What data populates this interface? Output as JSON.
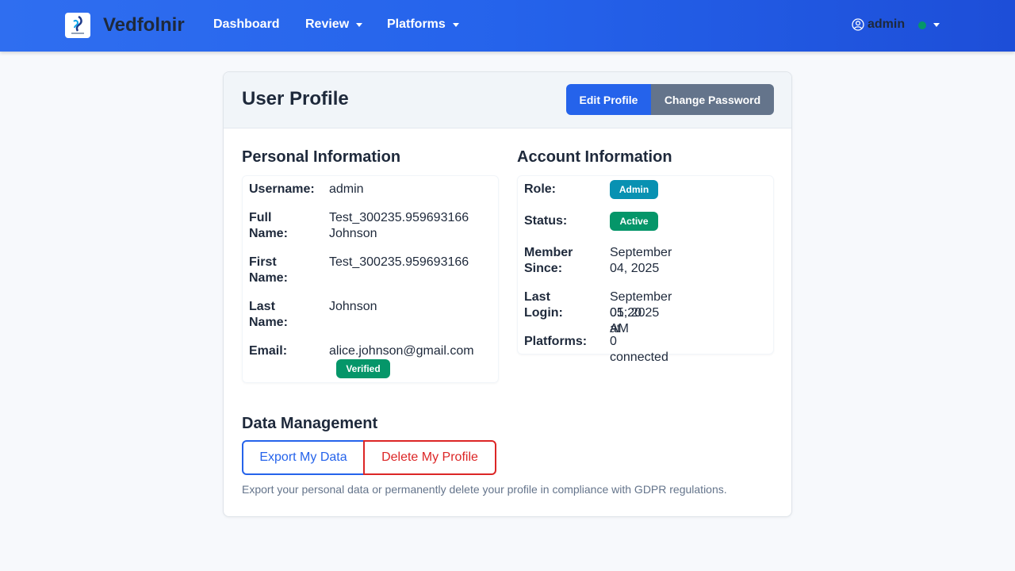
{
  "brand": {
    "name": "Vedfolnir"
  },
  "nav": {
    "dashboard": "Dashboard",
    "review": "Review",
    "platforms": "Platforms"
  },
  "user_menu": {
    "username": "admin",
    "status_color": "#059669"
  },
  "profile": {
    "title": "User Profile",
    "edit_button": "Edit Profile",
    "change_password_button": "Change Password",
    "personal": {
      "heading": "Personal Information",
      "username_label": "Username:",
      "username": "admin",
      "full_name_label": "Full Name:",
      "full_name_line1": "Test_300235.959693166",
      "full_name_line2": "Johnson",
      "first_name_label_1": "First",
      "first_name_label_2": "Name:",
      "first_name": "Test_300235.959693166",
      "last_name_label_1": "Last",
      "last_name_label_2": "Name:",
      "last_name": "Johnson",
      "email_label": "Email:",
      "email": "alice.johnson@gmail.com",
      "email_badge": "Verified"
    },
    "account": {
      "heading": "Account Information",
      "role_label": "Role:",
      "role": "Admin",
      "status_label": "Status:",
      "status": "Active",
      "member_since_label_1": "Member",
      "member_since_label_2": "Since:",
      "member_since": "September 04, 2025",
      "last_login_label": "Last Login:",
      "last_login_line1": "September 05, 2025 at",
      "last_login_line2": "01:20 AM",
      "platforms_label": "Platforms:",
      "platforms": "0 connected"
    },
    "data_management": {
      "heading": "Data Management",
      "export_button": "Export My Data",
      "delete_button": "Delete My Profile",
      "note": "Export your personal data or permanently delete your profile in compliance with GDPR regulations."
    }
  },
  "colors": {
    "primary": "#2563eb",
    "secondary": "#64748b",
    "success": "#059669",
    "info": "#0891b2",
    "danger": "#dc2626"
  },
  "icons": {
    "logo": "app-logo-icon",
    "user": "user-circle-icon",
    "caret": "caret-down-icon"
  }
}
